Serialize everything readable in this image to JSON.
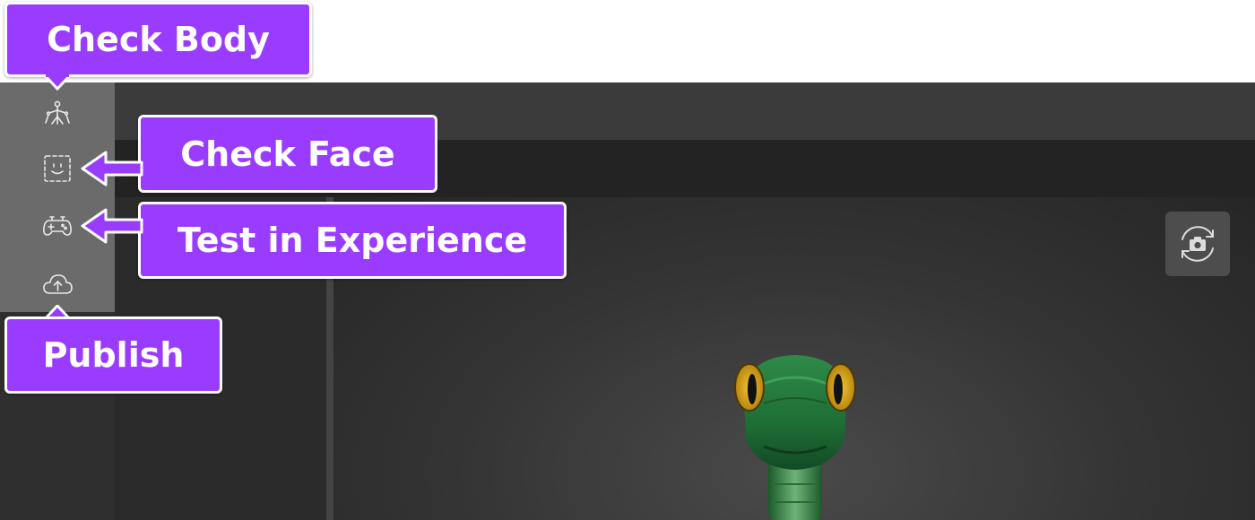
{
  "callouts": {
    "check_body": "Check Body",
    "check_face": "Check Face",
    "test_in_experience": "Test in Experience",
    "publish": "Publish"
  },
  "toolbar": {
    "items": [
      {
        "name": "check-body",
        "icon": "body-rig-icon"
      },
      {
        "name": "check-face",
        "icon": "face-frame-icon"
      },
      {
        "name": "test-in-experience",
        "icon": "gamepad-icon"
      },
      {
        "name": "publish",
        "icon": "cloud-upload-icon"
      }
    ]
  },
  "viewport": {
    "camera_button_icon": "rotate-camera-icon",
    "model": "green snake avatar"
  },
  "colors": {
    "callout_purple": "#9a3cff",
    "toolbar_gray": "#6b6b6b",
    "editor_dark": "#2f2f2f"
  }
}
